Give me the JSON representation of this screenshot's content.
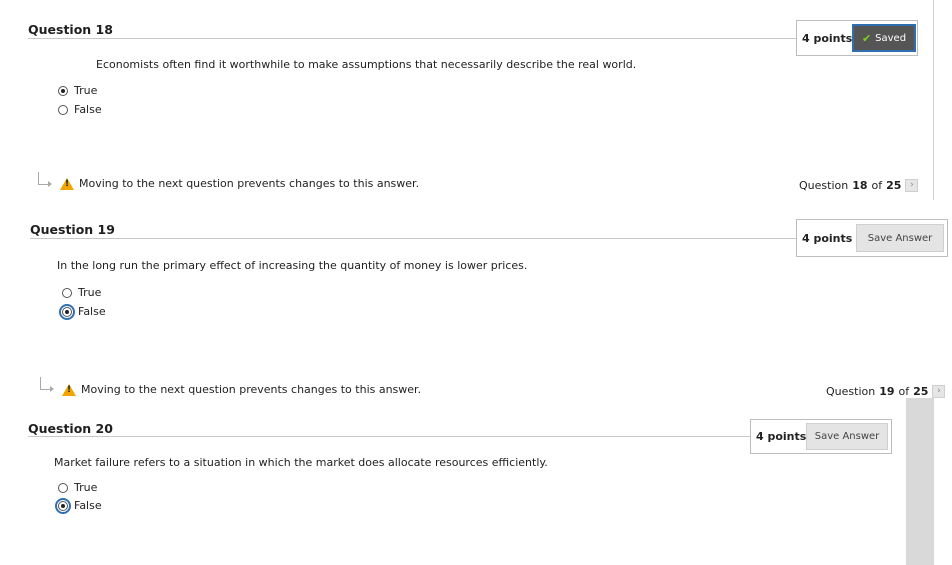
{
  "warning_text": "Moving to the next question prevents changes to this answer.",
  "questions": [
    {
      "title": "Question 18",
      "points": "4 points",
      "save_label": "Saved",
      "text": "Economists often find it worthwhile to make assumptions that necessarily describe the real world.",
      "options": [
        "True",
        "False"
      ],
      "selected": "True",
      "nav": {
        "prefix": "Question",
        "current": "18",
        "of": "of",
        "total": "25"
      }
    },
    {
      "title": "Question 19",
      "points": "4 points",
      "save_label": "Save Answer",
      "text": "In the long run the primary effect of increasing the quantity of money is lower prices.",
      "options": [
        "True",
        "False"
      ],
      "selected": "False",
      "nav": {
        "prefix": "Question",
        "current": "19",
        "of": "of",
        "total": "25"
      }
    },
    {
      "title": "Question 20",
      "points": "4 points",
      "save_label": "Save Answer",
      "text": "Market failure refers to a situation in which the market does allocate resources efficiently.",
      "options": [
        "True",
        "False"
      ],
      "selected": "False"
    }
  ],
  "icons": {
    "saved_check": "check-icon",
    "warning": "warning-icon",
    "next": "chevron-right-icon",
    "hint_arrow": "arrow-icon"
  },
  "colors": {
    "warning": "#f0a500",
    "saved_bg": "#555555",
    "focus": "#2f6fb0",
    "check": "#7ed321"
  }
}
